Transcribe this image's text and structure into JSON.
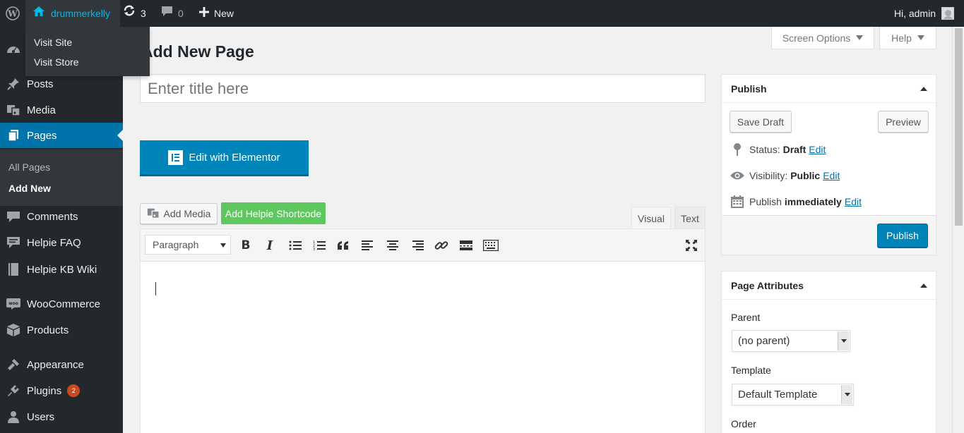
{
  "adminbar": {
    "site_name": "drummerkelly",
    "updates_count": "3",
    "comments_count": "0",
    "new_label": "New",
    "greeting": "Hi, admin",
    "dropdown": [
      "Visit Site",
      "Visit Store"
    ]
  },
  "sidebar": {
    "items": [
      {
        "label": "Posts",
        "icon": "pin-icon"
      },
      {
        "label": "Media",
        "icon": "media-icon"
      },
      {
        "label": "Pages",
        "icon": "pages-icon"
      },
      {
        "label": "Comments",
        "icon": "comment-icon"
      },
      {
        "label": "Helpie FAQ",
        "icon": "faq-icon"
      },
      {
        "label": "Helpie KB Wiki",
        "icon": "book-icon"
      },
      {
        "label": "WooCommerce",
        "icon": "woo-icon"
      },
      {
        "label": "Products",
        "icon": "box-icon"
      },
      {
        "label": "Appearance",
        "icon": "brush-icon"
      },
      {
        "label": "Plugins",
        "icon": "plugin-icon"
      },
      {
        "label": "Users",
        "icon": "user-icon"
      }
    ],
    "submenu": [
      "All Pages",
      "Add New"
    ],
    "plugins_badge": "2"
  },
  "header": {
    "screen_options": "Screen Options",
    "help": "Help",
    "title": "Add New Page"
  },
  "editor": {
    "title_placeholder": "Enter title here",
    "elementor_label": "Edit with Elementor",
    "add_media_label": "Add Media",
    "helpie_label": "Add Helpie Shortcode",
    "tab_visual": "Visual",
    "tab_text": "Text",
    "format_value": "Paragraph"
  },
  "publish": {
    "heading": "Publish",
    "save_draft": "Save Draft",
    "preview": "Preview",
    "status_label": "Status:",
    "status_value": "Draft",
    "visibility_label": "Visibility:",
    "visibility_value": "Public",
    "publish_label": "Publish",
    "publish_value": "immediately",
    "edit_link": "Edit",
    "publish_button": "Publish"
  },
  "attributes": {
    "heading": "Page Attributes",
    "parent_label": "Parent",
    "parent_value": "(no parent)",
    "template_label": "Template",
    "template_value": "Default Template",
    "order_label": "Order"
  },
  "colors": {
    "accent": "#0073aa",
    "adminbar": "#23282d",
    "helpie_green": "#5fc75f",
    "badge": "#ca4a1f"
  }
}
